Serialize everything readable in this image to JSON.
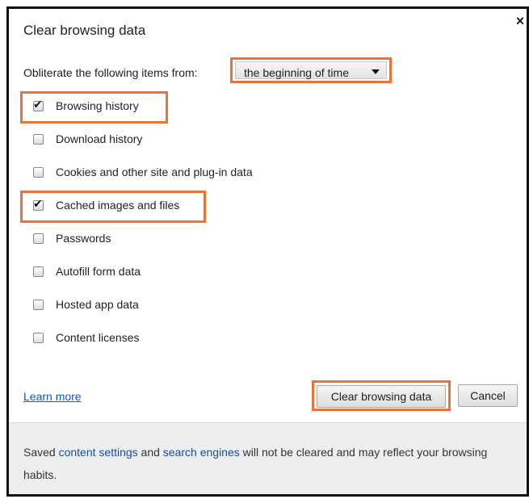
{
  "dialog": {
    "title": "Clear browsing data",
    "close_icon": "close-icon"
  },
  "time_range": {
    "label": "Obliterate the following items from:",
    "selected": "the beginning of time"
  },
  "options": [
    {
      "label": "Browsing history",
      "checked": true
    },
    {
      "label": "Download history",
      "checked": false
    },
    {
      "label": "Cookies and other site and plug-in data",
      "checked": false
    },
    {
      "label": "Cached images and files",
      "checked": true
    },
    {
      "label": "Passwords",
      "checked": false
    },
    {
      "label": "Autofill form data",
      "checked": false
    },
    {
      "label": "Hosted app data",
      "checked": false
    },
    {
      "label": "Content licenses",
      "checked": false
    }
  ],
  "actions": {
    "learn_more": "Learn more",
    "clear_label": "Clear browsing data",
    "cancel_label": "Cancel"
  },
  "footer": {
    "part1": "Saved ",
    "link1": "content settings",
    "part2": " and ",
    "link2": "search engines",
    "part3": " will not be cleared and may reflect your browsing habits."
  },
  "colors": {
    "highlight": "#e8743b",
    "link": "#1155cc"
  }
}
